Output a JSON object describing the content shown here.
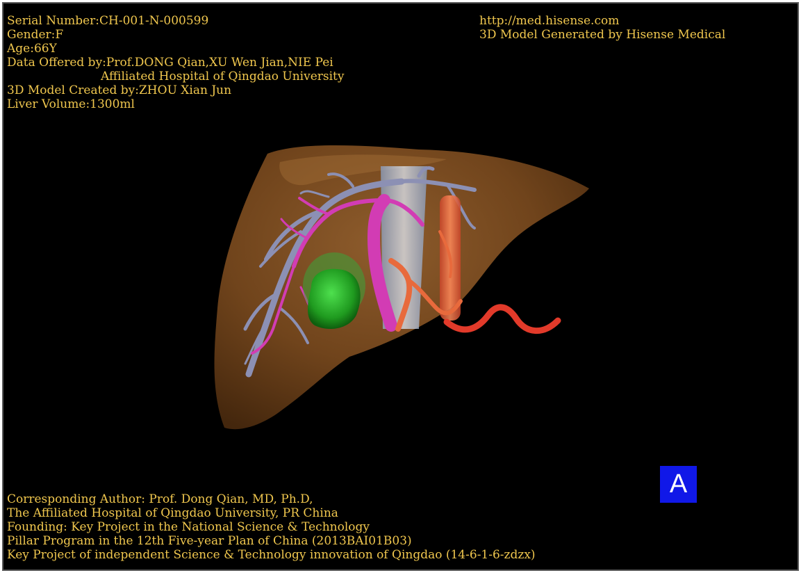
{
  "header_left": {
    "serial": "Serial Number:CH-001-N-000599",
    "gender": "Gender:F",
    "age": "Age:66Y",
    "data_offered": "Data Offered by:Prof.DONG Qian,XU Wen Jian,NIE Pei",
    "hospital": "Affiliated Hospital of Qingdao University",
    "created_by": "3D Model Created by:ZHOU Xian Jun",
    "liver_volume": "Liver Volume:1300ml"
  },
  "header_right": {
    "url": "http://med.hisense.com",
    "generator": "3D Model Generated by Hisense Medical"
  },
  "footer": {
    "line1": "Corresponding Author: Prof. Dong Qian, MD, Ph.D,",
    "line2": "The Affiliated Hospital of Qingdao University, PR China",
    "line3": "Founding: Key Project in the National Science & Technology",
    "line4": "Pillar Program in the 12th Five-year Plan of China (2013BAI01B03)",
    "line5": "Key Project of independent Science & Technology innovation of Qingdao (14-6-1-6-zdzx)"
  },
  "view_label": "A",
  "colors": {
    "text": "#f0c74e",
    "background": "#000000",
    "liver": "#7a4a1e",
    "portal_vein": "#8c90b4",
    "hepatic_artery": "#d23cb4",
    "vena_cava": "#b4c4dc",
    "aorta": "#e8643a",
    "tumor": "#2cb42c",
    "label_box": "#1018e8"
  },
  "model": {
    "description_icons": [
      "liver-surface",
      "portal-vein",
      "hepatic-artery",
      "inferior-vena-cava",
      "aorta",
      "tumor"
    ]
  }
}
